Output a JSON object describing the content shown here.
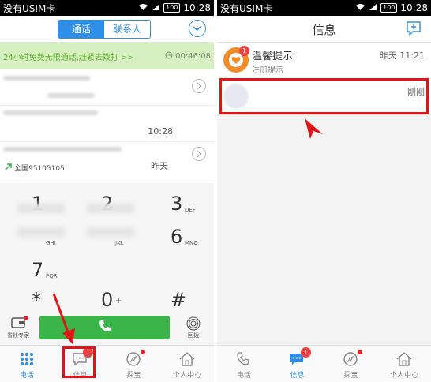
{
  "left": {
    "status": {
      "carrier": "没有USIM卡",
      "battery": "100",
      "time": "10:28"
    },
    "segment": {
      "calls": "通话",
      "contacts": "联系人"
    },
    "promo": {
      "text": "24小时免费无限通话,赶紧去拨打 >>",
      "timer": "00:46:08"
    },
    "calls": [
      {
        "time": ""
      },
      {
        "time": "10:28"
      },
      {
        "sub": "全国95105105",
        "time": "昨天"
      }
    ],
    "keys": [
      {
        "digit": "1",
        "letters": ""
      },
      {
        "digit": "2",
        "letters": ""
      },
      {
        "digit": "3",
        "letters": "DEF"
      },
      {
        "digit": "",
        "letters": "GHI"
      },
      {
        "digit": "",
        "letters": "JKL"
      },
      {
        "digit": "6",
        "letters": "MNO"
      },
      {
        "digit": "7",
        "letters": "PQR"
      },
      {
        "digit": "*",
        "letters": ""
      },
      {
        "digit": "0",
        "letters": "+"
      },
      {
        "digit": "#",
        "letters": ""
      }
    ],
    "actions": {
      "wallet": "省钱专家",
      "recall": "回拨"
    },
    "tabs": [
      {
        "label": "电话",
        "icon": "dialpad-icon"
      },
      {
        "label": "信息",
        "icon": "message-icon",
        "badge": "1"
      },
      {
        "label": "探宝",
        "icon": "compass-icon"
      },
      {
        "label": "个人中心",
        "icon": "home-icon"
      }
    ]
  },
  "right": {
    "status": {
      "carrier": "没有USIM卡",
      "battery": "100",
      "time": "10:28"
    },
    "title": "信息",
    "messages": [
      {
        "name": "温馨提示",
        "sub": "注册提示",
        "time": "昨天 11:21",
        "badge": "1"
      },
      {
        "name": "",
        "sub": "",
        "time": "刚刚"
      }
    ],
    "tabs": [
      {
        "label": "电话",
        "icon": "phone-icon"
      },
      {
        "label": "信息",
        "icon": "message-icon",
        "badge": "1"
      },
      {
        "label": "探宝",
        "icon": "compass-icon"
      },
      {
        "label": "个人中心",
        "icon": "home-icon"
      }
    ]
  },
  "colors": {
    "accent": "#2f8fe8",
    "green": "#3bb54a",
    "annotation": "#e01616",
    "promo_bg": "#d7f0c2"
  }
}
